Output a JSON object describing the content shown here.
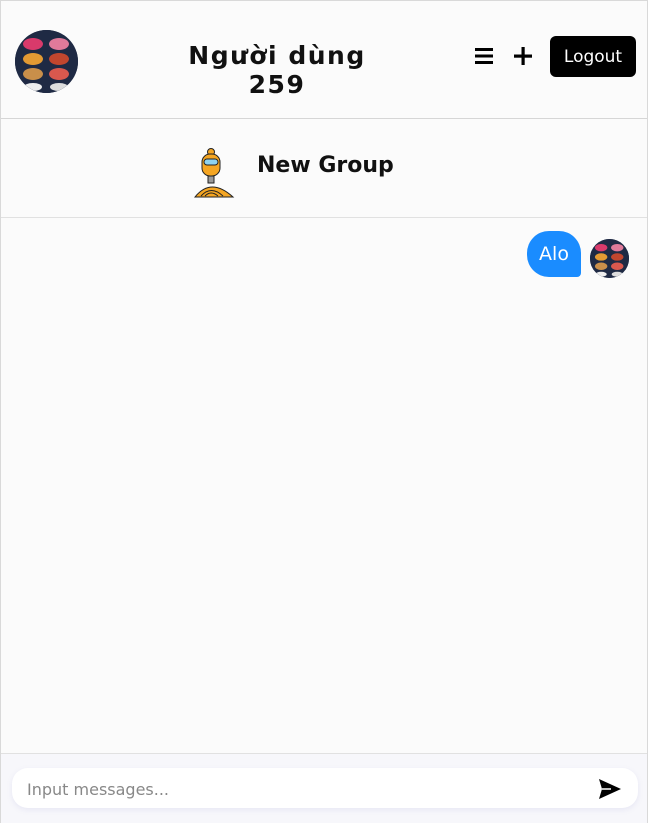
{
  "header": {
    "title": "Người dùng 259",
    "logout_label": "Logout",
    "menu_icon": "hamburger-menu-icon",
    "add_icon": "plus-icon"
  },
  "group": {
    "name": "New Group",
    "avatar_icon": "robot-avatar-icon"
  },
  "messages": [
    {
      "sender": "self",
      "text": "Alo"
    }
  ],
  "composer": {
    "placeholder": "Input messages...",
    "send_icon": "send-icon"
  },
  "colors": {
    "bubble": "#1a8cff",
    "logout_bg": "#000000",
    "robot_orange": "#f5a623"
  }
}
